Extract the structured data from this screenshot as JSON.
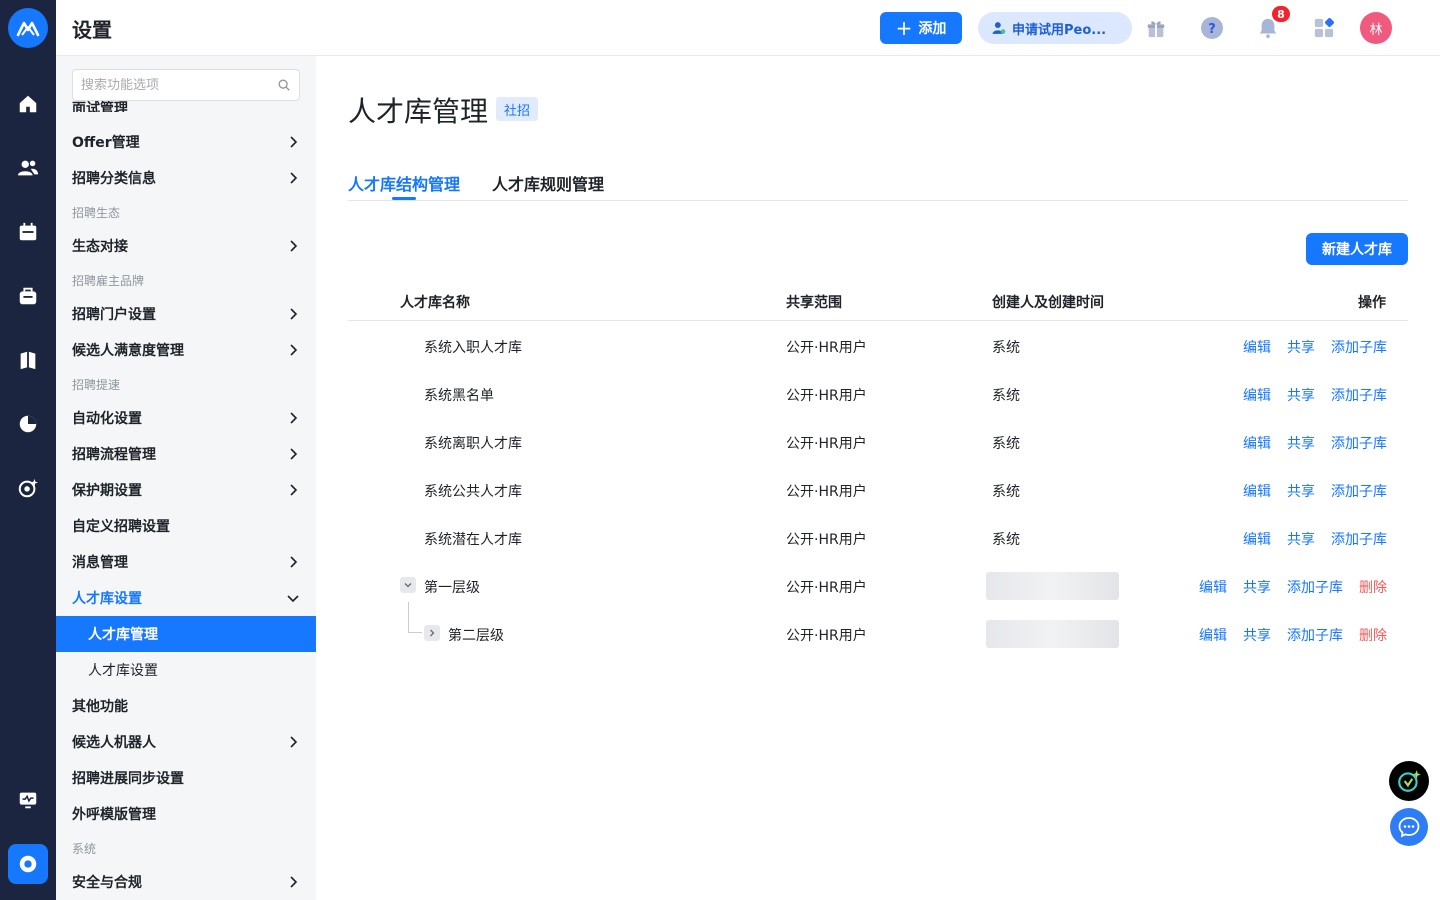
{
  "colors": {
    "accent": "#1677ff",
    "rail_bg": "#1b2540",
    "danger": "#f05b5b",
    "badge": "#f5222d"
  },
  "header": {
    "title": "设置",
    "add_label": "添加",
    "trial_label": "申请试用Peo...",
    "notification_count": "8",
    "avatar_text": "林",
    "icons": [
      "gift-icon",
      "help-icon",
      "bell-icon",
      "apps-icon"
    ]
  },
  "rail": {
    "icons": [
      "logo-icon",
      "home-icon",
      "users-icon",
      "calendar-icon",
      "briefcase-icon",
      "book-icon",
      "pie-chart-icon",
      "ai-target-icon",
      "monitor-icon",
      "settings-icon"
    ]
  },
  "sidebar": {
    "search_placeholder": "搜索功能选项",
    "partial_top": "面试管理",
    "items": [
      {
        "label": "Offer管理"
      },
      {
        "label": "招聘分类信息"
      },
      {
        "group": "招聘生态"
      },
      {
        "label": "生态对接"
      },
      {
        "group": "招聘雇主品牌"
      },
      {
        "label": "招聘门户设置"
      },
      {
        "label": "候选人满意度管理"
      },
      {
        "group": "招聘提速"
      },
      {
        "label": "自动化设置"
      },
      {
        "label": "招聘流程管理"
      },
      {
        "label": "保护期设置"
      },
      {
        "label": "自定义招聘设置"
      },
      {
        "label": "消息管理"
      },
      {
        "label": "人才库设置"
      },
      {
        "label": "人才库管理"
      },
      {
        "label": "人才库设置"
      },
      {
        "label": "其他功能"
      },
      {
        "label": "候选人机器人"
      },
      {
        "label": "招聘进展同步设置"
      },
      {
        "label": "外呼模版管理"
      },
      {
        "group": "系统"
      },
      {
        "label": "安全与合规"
      }
    ]
  },
  "main": {
    "title": "人才库管理",
    "tag": "社招",
    "tabs": [
      {
        "label": "人才库结构管理"
      },
      {
        "label": "人才库规则管理"
      }
    ],
    "new_button": "新建人才库",
    "columns": {
      "name": "人才库名称",
      "scope": "共享范围",
      "creator": "创建人及创建时间",
      "actions": "操作"
    },
    "actions": {
      "edit": "编辑",
      "share": "共享",
      "add_sub": "添加子库",
      "delete": "删除"
    },
    "rows": [
      {
        "name": "系统入职人才库",
        "scope": "公开·HR用户",
        "creator": "系统"
      },
      {
        "name": "系统黑名单",
        "scope": "公开·HR用户",
        "creator": "系统"
      },
      {
        "name": "系统离职人才库",
        "scope": "公开·HR用户",
        "creator": "系统"
      },
      {
        "name": "系统公共人才库",
        "scope": "公开·HR用户",
        "creator": "系统"
      },
      {
        "name": "系统潜在人才库",
        "scope": "公开·HR用户",
        "creator": "系统"
      },
      {
        "name": "第一层级",
        "scope": "公开·HR用户",
        "creator": ""
      },
      {
        "name": "第二层级",
        "scope": "公开·HR用户",
        "creator": ""
      }
    ]
  }
}
